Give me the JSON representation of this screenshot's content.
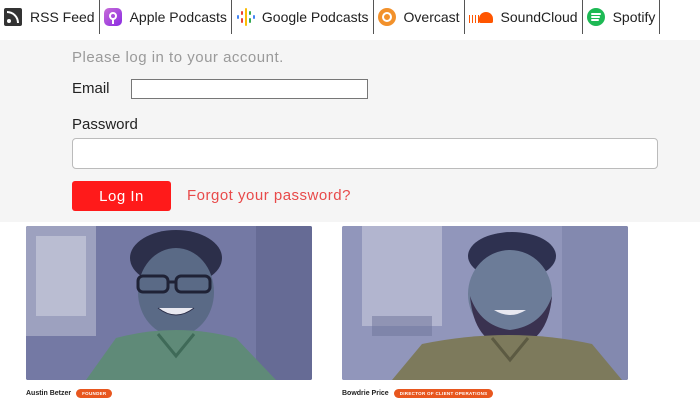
{
  "podcast_links": [
    {
      "label": "RSS Feed",
      "icon": "rss-icon"
    },
    {
      "label": "Apple Podcasts",
      "icon": "apple-podcasts-icon"
    },
    {
      "label": "Google Podcasts",
      "icon": "google-podcasts-icon"
    },
    {
      "label": "Overcast",
      "icon": "overcast-icon"
    },
    {
      "label": "SoundCloud",
      "icon": "soundcloud-icon"
    },
    {
      "label": "Spotify",
      "icon": "spotify-icon"
    }
  ],
  "login": {
    "prompt": "Please log in to your account.",
    "email_label": "Email",
    "email_value": "",
    "password_label": "Password",
    "password_value": "",
    "login_button": "Log In",
    "forgot_link": "Forgot your password?"
  },
  "team": [
    {
      "name": "Austin Betzer",
      "role": "FOUNDER"
    },
    {
      "name": "Bowdrie Price",
      "role": "DIRECTOR OF CLIENT OPERATIONS"
    }
  ],
  "colors": {
    "accent_red": "#ff1a1a",
    "link_red": "#e84a4a",
    "role_badge": "#e8571f",
    "panel_bg": "#f5f5f5"
  }
}
